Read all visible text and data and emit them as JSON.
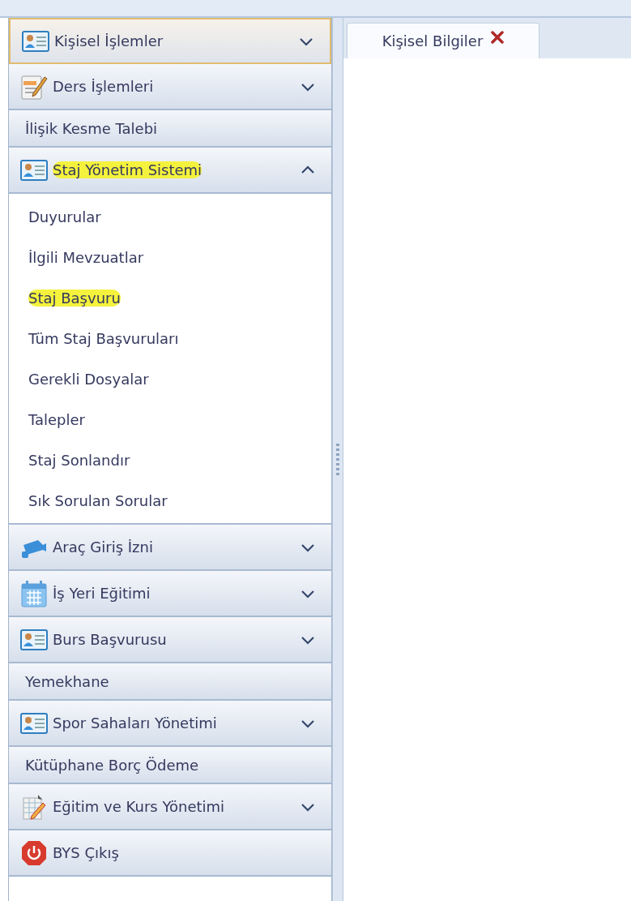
{
  "sidebar": {
    "items": [
      {
        "label": "Kişisel İşlemler",
        "kind": "expandable",
        "expanded": false,
        "hovered": true,
        "highlighted": false
      },
      {
        "label": "Ders İşlemleri",
        "kind": "expandable",
        "expanded": false,
        "hovered": false,
        "highlighted": false
      },
      {
        "label": "İlişik Kesme Talebi",
        "kind": "link",
        "hovered": false,
        "highlighted": false
      },
      {
        "label": "Staj Yönetim Sistemi",
        "kind": "expandable",
        "expanded": true,
        "hovered": false,
        "highlighted": true,
        "children": [
          {
            "label": "Duyurular",
            "highlighted": false
          },
          {
            "label": "İlgili Mevzuatlar",
            "highlighted": false
          },
          {
            "label": "Staj Başvuru",
            "highlighted": true
          },
          {
            "label": "Tüm Staj Başvuruları",
            "highlighted": false
          },
          {
            "label": "Gerekli Dosyalar",
            "highlighted": false
          },
          {
            "label": "Talepler",
            "highlighted": false
          },
          {
            "label": "Staj Sonlandır",
            "highlighted": false
          },
          {
            "label": "Sık Sorulan Sorular",
            "highlighted": false
          }
        ]
      },
      {
        "label": "Araç Giriş İzni",
        "kind": "expandable",
        "expanded": false,
        "hovered": false,
        "highlighted": false
      },
      {
        "label": "İş Yeri Eğitimi",
        "kind": "expandable",
        "expanded": false,
        "hovered": false,
        "highlighted": false
      },
      {
        "label": "Burs Başvurusu",
        "kind": "expandable",
        "expanded": false,
        "hovered": false,
        "highlighted": false
      },
      {
        "label": "Yemekhane",
        "kind": "link",
        "hovered": false,
        "highlighted": false
      },
      {
        "label": "Spor Sahaları Yönetimi",
        "kind": "expandable",
        "expanded": false,
        "hovered": false,
        "highlighted": false
      },
      {
        "label": "Kütüphane Borç Ödeme",
        "kind": "link",
        "hovered": false,
        "highlighted": false
      },
      {
        "label": "Eğitim ve Kurs Yönetimi",
        "kind": "expandable",
        "expanded": false,
        "hovered": false,
        "highlighted": false
      },
      {
        "label": "BYS Çıkış",
        "kind": "action",
        "hovered": false,
        "highlighted": false
      }
    ]
  },
  "tabs": [
    {
      "label": "Kişisel Bilgiler",
      "selected": true,
      "closable": true
    }
  ]
}
